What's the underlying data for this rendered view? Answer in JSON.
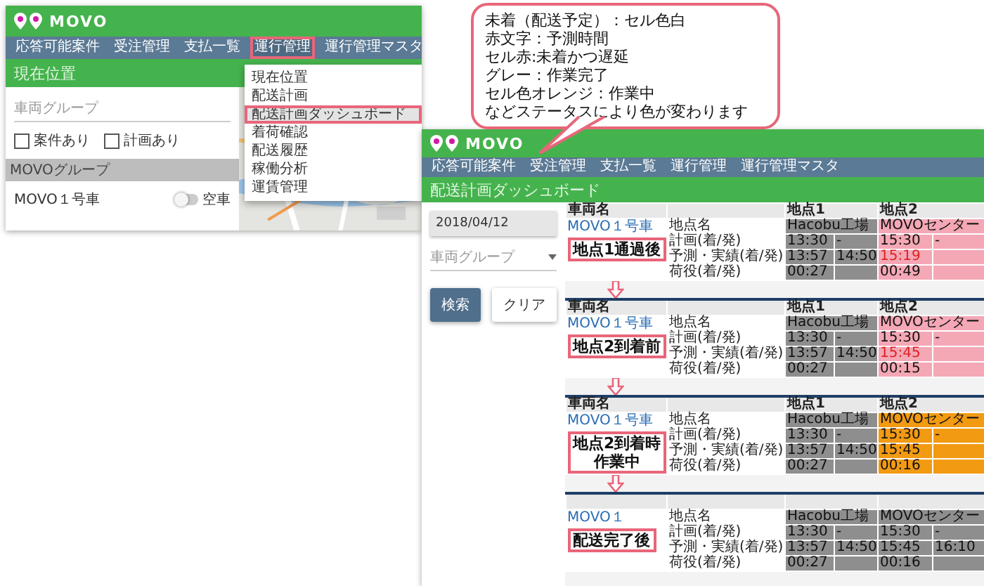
{
  "callout": {
    "lines": [
      "未着（配送予定）：セル色白",
      "赤文字：予測時間",
      "セル赤:未着かつ遅延",
      "グレー：作業完了",
      "セル色オレンジ：作業中",
      "などステータスにより色が変わります"
    ]
  },
  "current_screen": {
    "logo": "MOVO",
    "nav": [
      {
        "label": "応答可能案件",
        "selected": false
      },
      {
        "label": "受注管理",
        "selected": false
      },
      {
        "label": "支払一覧",
        "selected": false
      },
      {
        "label": "運行管理",
        "selected": true
      },
      {
        "label": "運行管理マスタ",
        "selected": false
      }
    ],
    "menu": [
      {
        "label": "現在位置",
        "selected": false
      },
      {
        "label": "配送計画",
        "selected": false
      },
      {
        "label": "配送計画ダッシュボード",
        "selected": true
      },
      {
        "label": "着荷確認",
        "selected": false
      },
      {
        "label": "配送履歴",
        "selected": false
      },
      {
        "label": "稼働分析",
        "selected": false
      },
      {
        "label": "運賃管理",
        "selected": false
      }
    ],
    "title": "現在位置",
    "group_field": {
      "placeholder": "車両グループ"
    },
    "checkboxes": [
      {
        "label": "案件あり",
        "checked": false
      },
      {
        "label": "計画あり",
        "checked": false
      }
    ],
    "group": "MOVOグループ",
    "vehicles": [
      {
        "name": "MOVO１号車",
        "toggle_label": "空車",
        "on": false
      }
    ]
  },
  "dashboard_screen": {
    "logo": "MOVO",
    "nav": [
      "応答可能案件",
      "受注管理",
      "支払一覧",
      "運行管理",
      "運行管理マスタ"
    ],
    "title": "配送計画ダッシュボード",
    "date": "2018/04/12",
    "group_select": {
      "placeholder": "車両グループ"
    },
    "buttons": [
      {
        "label": "検索",
        "kind": "primary"
      },
      {
        "label": "クリア",
        "kind": "secondary"
      }
    ]
  },
  "status_tables": [
    {
      "status": [
        "地点1通過後"
      ],
      "vehicle_header": "車両名",
      "vehicle": "MOVO１号車",
      "row_labels": [
        "地点名",
        "計画(着/発)",
        "予測・実績(着/発)",
        "荷役(着/発)"
      ],
      "points": [
        {
          "header": "地点1",
          "name": "Hacobu工場",
          "color": "#8e8e8e",
          "plan": [
            "13:30",
            "-"
          ],
          "actual": [
            "13:57",
            "14:50"
          ],
          "actual_late": false,
          "dwell": "00:27"
        },
        {
          "header": "地点2",
          "name": "MOVOセンター",
          "color": "#f4a7b5",
          "plan": [
            "15:30",
            "-"
          ],
          "actual": [
            "15:19"
          ],
          "actual_late": true,
          "dwell": "00:49"
        }
      ]
    },
    {
      "status": [
        "地点2到着前"
      ],
      "vehicle_header": "車両名",
      "vehicle": "MOVO１号車",
      "row_labels": [
        "地点名",
        "計画(着/発)",
        "予測・実績(着/発)",
        "荷役(着/発)"
      ],
      "points": [
        {
          "header": "地点1",
          "name": "Hacobu工場",
          "color": "#8e8e8e",
          "plan": [
            "13:30",
            "-"
          ],
          "actual": [
            "13:57",
            "14:50"
          ],
          "actual_late": false,
          "dwell": "00:27"
        },
        {
          "header": "地点2",
          "name": "MOVOセンター",
          "color": "#f4a7b5",
          "plan": [
            "15:30",
            "-"
          ],
          "actual": [
            "15:45"
          ],
          "actual_late": true,
          "dwell": "00:15"
        }
      ]
    },
    {
      "status": [
        "地点2到着時",
        "作業中"
      ],
      "vehicle_header": "車両名",
      "vehicle": "MOVO１号車",
      "row_labels": [
        "地点名",
        "計画(着/発)",
        "予測・実績(着/発)",
        "荷役(着/発)"
      ],
      "points": [
        {
          "header": "地点1",
          "name": "Hacobu工場",
          "color": "#8e8e8e",
          "plan": [
            "13:30",
            "-"
          ],
          "actual": [
            "13:57",
            "14:50"
          ],
          "actual_late": false,
          "dwell": "00:27"
        },
        {
          "header": "地点2",
          "name": "MOVOセンター",
          "color": "#f29a12",
          "plan": [
            "15:30",
            "-"
          ],
          "actual": [
            "15:45"
          ],
          "actual_late": false,
          "dwell": "00:16"
        }
      ]
    },
    {
      "status": [
        "配送完了後"
      ],
      "vehicle": "MOVO１",
      "row_labels": [
        "地点名",
        "計画(着/発)",
        "予測・実績(着/発)",
        "荷役(着/発)"
      ],
      "points": [
        {
          "name": "Hacobu工場",
          "color": "#8e8e8e",
          "plan": [
            "13:30",
            "-"
          ],
          "actual": [
            "13:57",
            "14:50"
          ],
          "actual_late": false,
          "dwell": "00:27"
        },
        {
          "name": "MOVOセンター",
          "color": "#8e8e8e",
          "plan": [
            "15:30",
            "-"
          ],
          "actual": [
            "15:45",
            "16:10"
          ],
          "actual_late": false,
          "dwell": "00:16"
        }
      ]
    }
  ]
}
